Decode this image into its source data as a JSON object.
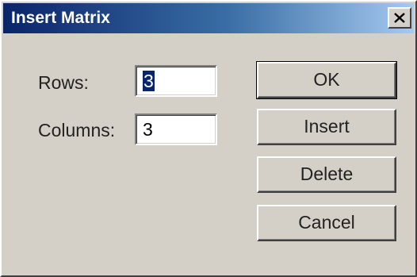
{
  "dialog": {
    "title": "Insert Matrix",
    "close_label": "close"
  },
  "fields": {
    "rows_label": "Rows:",
    "rows_value": "3",
    "columns_label": "Columns:",
    "columns_value": "3"
  },
  "buttons": {
    "ok": "OK",
    "insert": "Insert",
    "delete": "Delete",
    "cancel": "Cancel"
  },
  "colors": {
    "titlebar_start": "#0a246a",
    "titlebar_end": "#a6caf0",
    "dialog_face": "#d4d0c8",
    "selection": "#0a246a"
  },
  "icons": {
    "close": "close-icon"
  }
}
